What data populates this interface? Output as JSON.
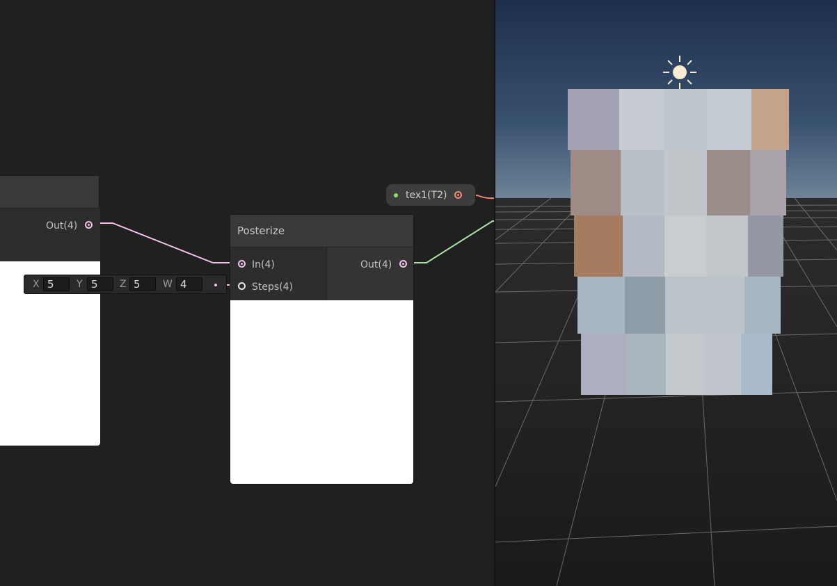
{
  "left_node": {
    "output_label": "Out(4)",
    "vector": {
      "x_label": "X",
      "x_value": "5",
      "y_label": "Y",
      "y_value": "5",
      "z_label": "Z",
      "z_value": "5",
      "w_label": "W",
      "w_value": "4"
    }
  },
  "posterize_node": {
    "title": "Posterize",
    "inputs": [
      "In(4)",
      "Steps(4)"
    ],
    "output_label": "Out(4)"
  },
  "property_node": {
    "label": "tex1(T2)"
  },
  "colors": {
    "graph_bg": "#202020",
    "edge_vector4": "#f3c3ec",
    "edge_vector3": "#a8e6a3",
    "edge_texture": "#f08a7a",
    "property_dot": "#8ee06b"
  }
}
